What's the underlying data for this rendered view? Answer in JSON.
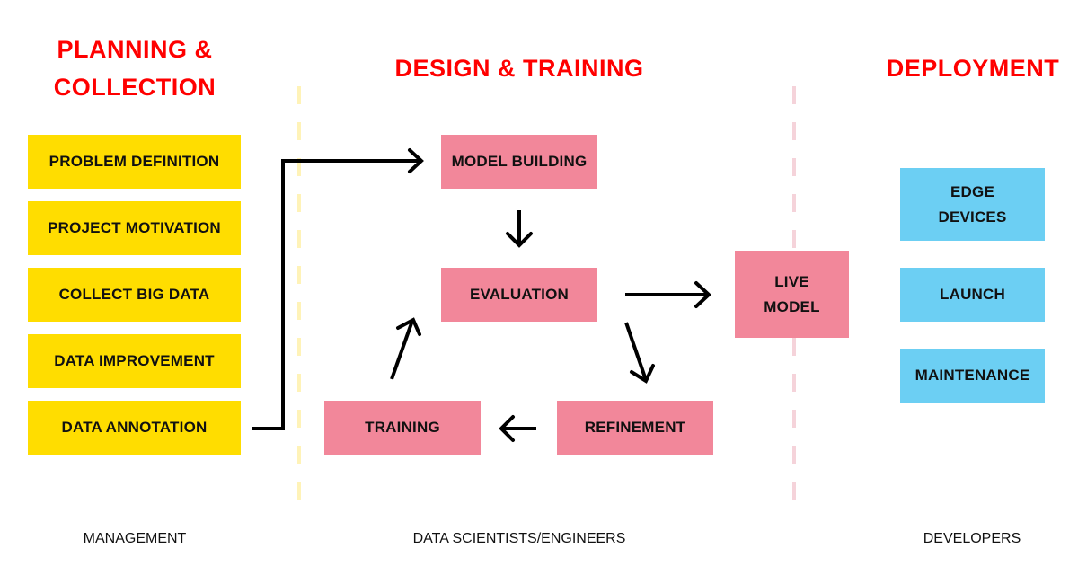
{
  "colors": {
    "heading": "#ff0000",
    "planning_box": "#ffdd00",
    "design_box": "#f2879a",
    "deployment_box": "#6ccff3",
    "divider_left": "#fff3b8",
    "divider_right": "#f5d3da",
    "arrow": "#000000"
  },
  "columns": {
    "planning": {
      "heading": "PLANNING & COLLECTION",
      "heading_line1": "PLANNING &",
      "heading_line2": "COLLECTION",
      "items": [
        "PROBLEM DEFINITION",
        "PROJECT MOTIVATION",
        "COLLECT BIG DATA",
        "DATA IMPROVEMENT",
        "DATA ANNOTATION"
      ],
      "footer": "MANAGEMENT"
    },
    "design": {
      "heading": "DESIGN & TRAINING",
      "nodes": {
        "model_building": "MODEL BUILDING",
        "evaluation": "EVALUATION",
        "training": "TRAINING",
        "refinement": "REFINEMENT",
        "live_model_line1": "LIVE",
        "live_model_line2": "MODEL"
      },
      "footer": "DATA SCIENTISTS/ENGINEERS"
    },
    "deployment": {
      "heading": "DEPLOYMENT",
      "items": [
        {
          "line1": "EDGE",
          "line2": "DEVICES"
        },
        {
          "line1": "LAUNCH"
        },
        {
          "line1": "MAINTENANCE"
        }
      ],
      "footer": "DEVELOPERS"
    }
  },
  "edges": [
    {
      "from": "DATA ANNOTATION",
      "to": "MODEL BUILDING"
    },
    {
      "from": "MODEL BUILDING",
      "to": "EVALUATION"
    },
    {
      "from": "EVALUATION",
      "to": "LIVE MODEL"
    },
    {
      "from": "EVALUATION",
      "to": "REFINEMENT"
    },
    {
      "from": "REFINEMENT",
      "to": "TRAINING"
    },
    {
      "from": "TRAINING",
      "to": "EVALUATION"
    }
  ]
}
